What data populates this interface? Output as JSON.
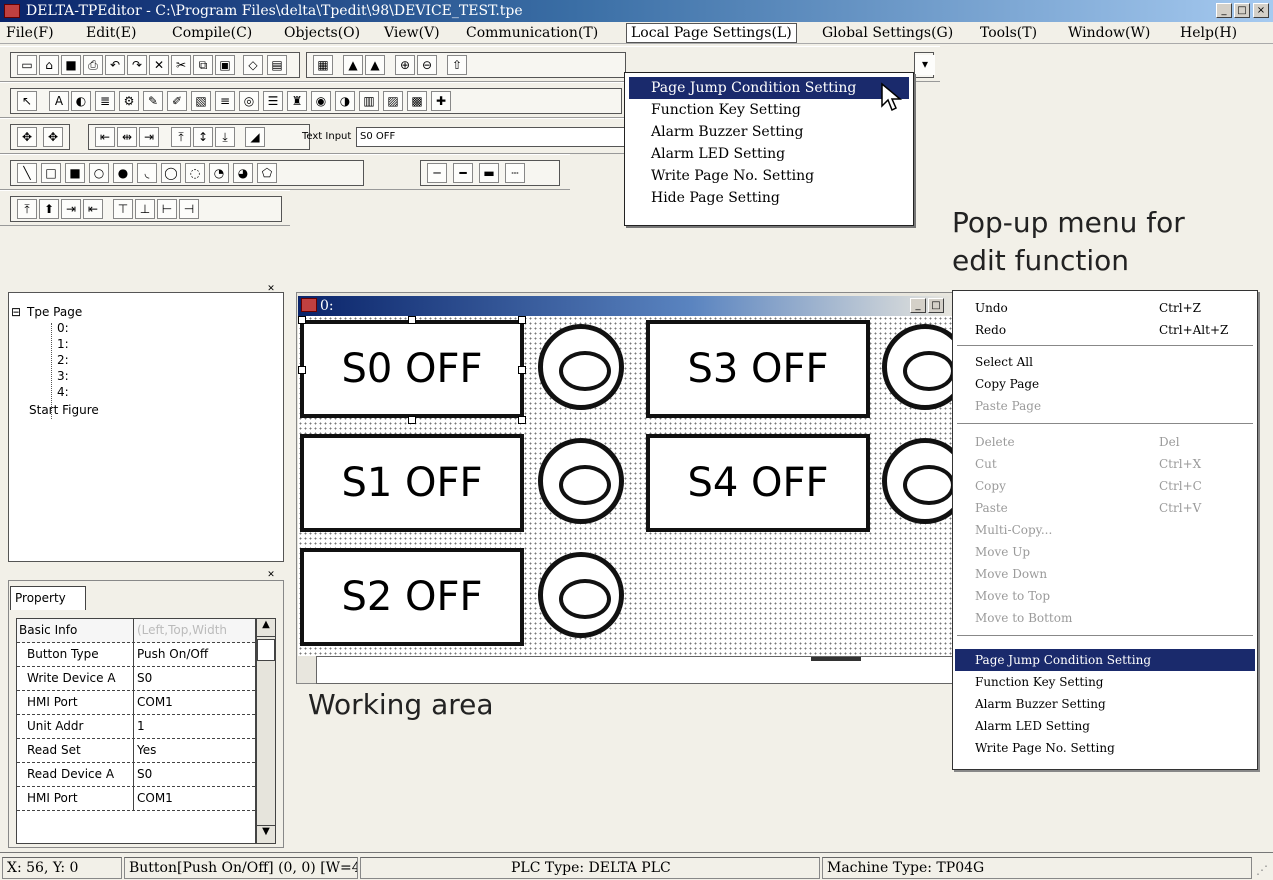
{
  "window": {
    "title": "DELTA-TPEditor - C:\\Program Files\\delta\\Tpedit\\98\\DEVICE_TEST.tpe",
    "min": "_",
    "max": "□",
    "close": "×"
  },
  "menubar": {
    "items": [
      "File(F)",
      "Edit(E)",
      "Compile(C)",
      "Objects(O)",
      "View(V)",
      "Communication(T)",
      "Local Page Settings(L)",
      "Global Settings(G)",
      "Tools(T)",
      "Window(W)",
      "Help(H)"
    ]
  },
  "toolbar": {
    "text_input_label": "Text Input",
    "text_input_value": "S0 OFF"
  },
  "local_menu_dropdown": {
    "items": [
      "Page Jump Condition Setting",
      "Function Key Setting",
      "Alarm Buzzer Setting",
      "Alarm LED Setting",
      "Write Page No. Setting",
      "Hide Page Setting"
    ],
    "selected_index": 0
  },
  "annotations": {
    "popup_line1": "Pop-up menu for",
    "popup_line2": "edit function",
    "working_area": "Working area"
  },
  "tree": {
    "root": "Tpe Page",
    "pages": [
      "0:",
      "1:",
      "2:",
      "3:",
      "4:"
    ],
    "start_figure": "Start Figure"
  },
  "property_panel": {
    "tab": "Property",
    "section": "Basic Info",
    "section_value": "(Left,Top,Width",
    "rows": [
      {
        "key": "Button Type",
        "value": "Push On/Off"
      },
      {
        "key": "Write Device A",
        "value": "S0"
      },
      {
        "key": "HMI Port",
        "value": "COM1"
      },
      {
        "key": "Unit Addr",
        "value": "1"
      },
      {
        "key": "Read Set",
        "value": "Yes"
      },
      {
        "key": "Read Device A",
        "value": "S0"
      },
      {
        "key": "HMI Port",
        "value": "COM1"
      }
    ]
  },
  "working_area": {
    "window_title": "0:",
    "buttons": [
      "S0 OFF",
      "S1 OFF",
      "S2 OFF",
      "S3 OFF",
      "S4 OFF"
    ]
  },
  "context_menu": {
    "items": [
      {
        "label": "Undo",
        "shortcut": "Ctrl+Z",
        "enabled": true
      },
      {
        "label": "Redo",
        "shortcut": "Ctrl+Alt+Z",
        "enabled": true
      },
      {
        "label": "Select All",
        "shortcut": "",
        "enabled": true
      },
      {
        "label": "Copy Page",
        "shortcut": "",
        "enabled": true
      },
      {
        "label": "Paste Page",
        "shortcut": "",
        "enabled": false
      },
      {
        "label": "Delete",
        "shortcut": "Del",
        "enabled": false
      },
      {
        "label": "Cut",
        "shortcut": "Ctrl+X",
        "enabled": false
      },
      {
        "label": "Copy",
        "shortcut": "Ctrl+C",
        "enabled": false
      },
      {
        "label": "Paste",
        "shortcut": "Ctrl+V",
        "enabled": false
      },
      {
        "label": "Multi-Copy...",
        "shortcut": "",
        "enabled": false
      },
      {
        "label": "Move Up",
        "shortcut": "",
        "enabled": false
      },
      {
        "label": "Move Down",
        "shortcut": "",
        "enabled": false
      },
      {
        "label": "Move to Top",
        "shortcut": "",
        "enabled": false
      },
      {
        "label": "Move to Bottom",
        "shortcut": "",
        "enabled": false
      },
      {
        "label": "Page Jump Condition Setting",
        "shortcut": "",
        "enabled": true
      },
      {
        "label": "Function Key Setting",
        "shortcut": "",
        "enabled": true
      },
      {
        "label": "Alarm Buzzer Setting",
        "shortcut": "",
        "enabled": true
      },
      {
        "label": "Alarm LED Setting",
        "shortcut": "",
        "enabled": true
      },
      {
        "label": "Write Page No. Setting",
        "shortcut": "",
        "enabled": true
      }
    ],
    "selected_index": 14
  },
  "statusbar": {
    "coords": "X: 56, Y: 0",
    "object": "Button[Push On/Off] (0, 0) [W=4",
    "plc_type": "PLC Type: DELTA PLC",
    "machine_type": "Machine Type: TP04G"
  }
}
